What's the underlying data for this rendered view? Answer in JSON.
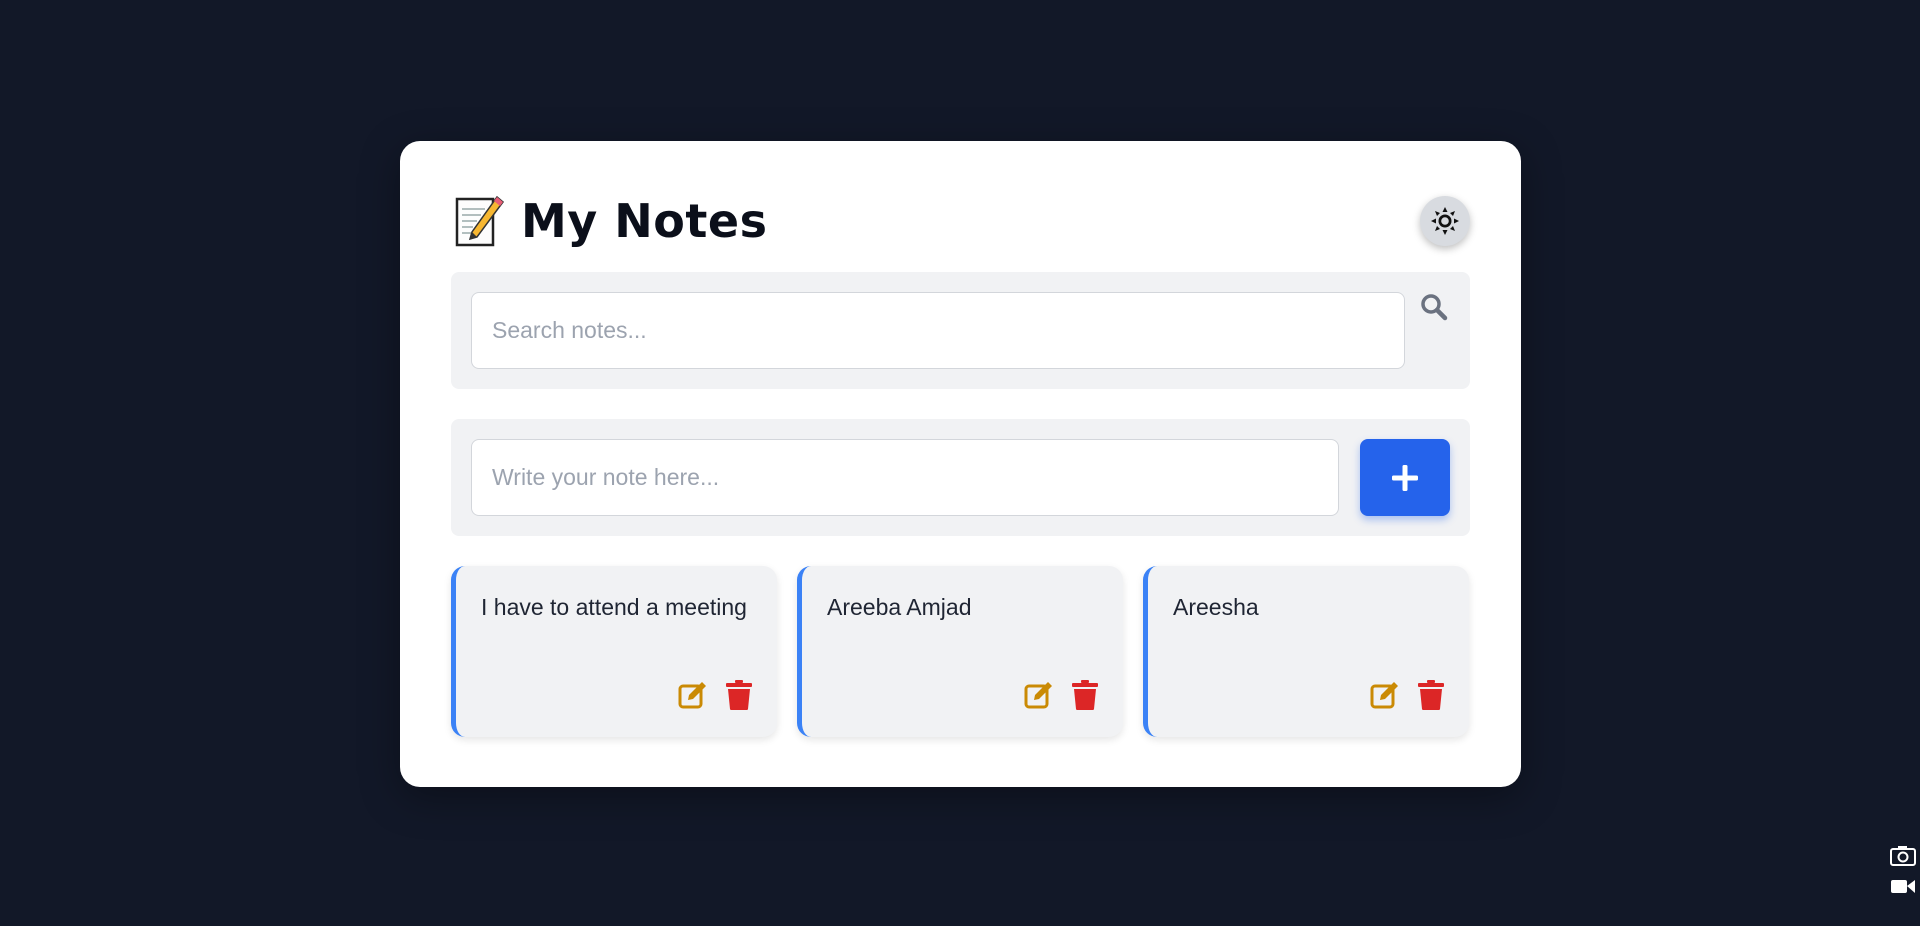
{
  "app": {
    "title": "My Notes",
    "title_emoji_icon": "memo-icon",
    "theme_toggle_icon": "sun-icon"
  },
  "search": {
    "placeholder": "Search notes...",
    "value": "",
    "icon": "search-icon"
  },
  "composer": {
    "placeholder": "Write your note here...",
    "value": "",
    "add_icon": "plus-icon"
  },
  "notes": [
    {
      "text": "I have to attend a meeting",
      "edit_icon": "edit-icon",
      "delete_icon": "trash-icon"
    },
    {
      "text": "Areeba Amjad",
      "edit_icon": "edit-icon",
      "delete_icon": "trash-icon"
    },
    {
      "text": "Areesha",
      "edit_icon": "edit-icon",
      "delete_icon": "trash-icon"
    }
  ],
  "colors": {
    "background": "#121828",
    "card": "#ffffff",
    "accent": "#2563eb",
    "note_border": "#3b82f6",
    "edit": "#ca8a04",
    "delete": "#dc2626"
  }
}
